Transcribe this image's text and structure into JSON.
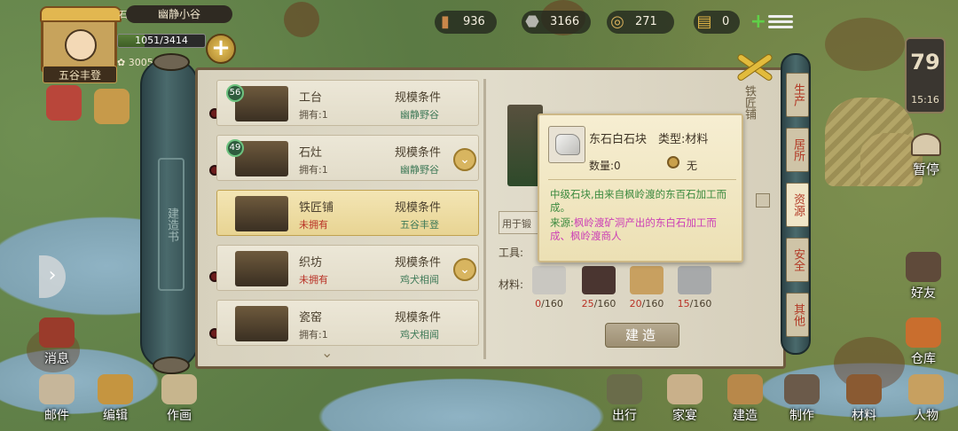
{
  "player": {
    "village": "幽静小谷",
    "village_prefix": "石",
    "name": "五谷丰登",
    "hp": "1051/3414",
    "hp_ratio": 0.31,
    "stars": "3005"
  },
  "resources": [
    {
      "icon": "wood-icon",
      "value": "936",
      "color": "#8b5a2b"
    },
    {
      "icon": "stone-icon",
      "value": "3166",
      "color": "#7a7a74"
    },
    {
      "icon": "coin-icon",
      "value": "271",
      "color": "#a07a3a"
    },
    {
      "icon": "ticket-icon",
      "value": "0",
      "color": "#b08a3a"
    }
  ],
  "day": {
    "number": "79",
    "time": "15:16"
  },
  "pause_label": "暂停",
  "scroll_label": "建造书",
  "buildings": [
    {
      "level": "56",
      "name": "工台",
      "owned": "拥有:1",
      "owned_red": false,
      "cond": "规模条件",
      "cond_val": "幽静野谷",
      "chev": false,
      "selected": false
    },
    {
      "level": "49",
      "name": "石灶",
      "owned": "拥有:1",
      "owned_red": false,
      "cond": "规模条件",
      "cond_val": "幽静野谷",
      "chev": true,
      "selected": false
    },
    {
      "level": "",
      "name": "铁匠铺",
      "owned": "未拥有",
      "owned_red": true,
      "cond": "规模条件",
      "cond_val": "五谷丰登",
      "chev": false,
      "selected": true
    },
    {
      "level": "",
      "name": "织坊",
      "owned": "未拥有",
      "owned_red": true,
      "cond": "规模条件",
      "cond_val": "鸡犬相闻",
      "chev": true,
      "selected": false
    },
    {
      "level": "",
      "name": "瓷窑",
      "owned": "拥有:1",
      "owned_red": false,
      "cond": "规模条件",
      "cond_val": "鸡犬相闻",
      "chev": false,
      "selected": false
    }
  ],
  "detail": {
    "title": "铁匠铺",
    "use_text": "用于锻",
    "tool_label": "工具:",
    "mat_label": "材料:",
    "build_label": "建造",
    "materials": [
      {
        "icon": "stone-block-icon",
        "have": "0",
        "need": "/160",
        "color": "#c9c7c1"
      },
      {
        "icon": "ore-icon",
        "have": "25",
        "need": "/160",
        "color": "#4a3530"
      },
      {
        "icon": "bucket-icon",
        "have": "20",
        "need": "/160",
        "color": "#c8a060"
      },
      {
        "icon": "metal-icon",
        "have": "15",
        "need": "/160",
        "color": "#a7a9aa"
      }
    ]
  },
  "tooltip": {
    "name": "东石白石块",
    "type": "类型:材料",
    "qty": "数量:0",
    "price": "无",
    "desc": "中级石块,由来自枫岭渡的东百石加工而成。",
    "src_label": "来源:",
    "src": "枫岭渡矿洞产出的东白石加工而成、枫岭渡商人"
  },
  "tabs": [
    {
      "label": "生产",
      "active": false
    },
    {
      "label": "居所",
      "active": false
    },
    {
      "label": "资源",
      "active": true
    },
    {
      "label": "安全",
      "active": false
    },
    {
      "label": "其他",
      "active": false
    }
  ],
  "left_nav": [
    {
      "icon": "messages-icon",
      "label": "消息"
    },
    {
      "icon": "mail-icon",
      "label": "邮件"
    },
    {
      "icon": "edit-icon",
      "label": "编辑"
    },
    {
      "icon": "painting-icon",
      "label": "作画"
    }
  ],
  "right_nav": [
    {
      "icon": "friends-icon",
      "label": "好友"
    },
    {
      "icon": "warehouse-icon",
      "label": "仓库"
    }
  ],
  "bottom_nav": [
    {
      "icon": "travel-icon",
      "label": "出行"
    },
    {
      "icon": "family-icon",
      "label": "家宴"
    },
    {
      "icon": "build-icon",
      "label": "建造"
    },
    {
      "icon": "craft-icon",
      "label": "制作"
    },
    {
      "icon": "material-icon",
      "label": "材料"
    },
    {
      "icon": "people-icon",
      "label": "人物"
    }
  ]
}
